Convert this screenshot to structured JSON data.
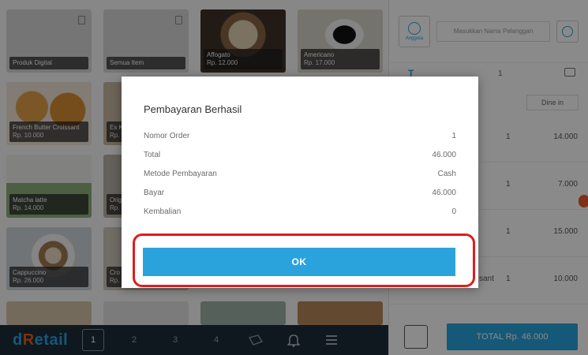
{
  "products": [
    {
      "name": "Produk Digital",
      "price": ""
    },
    {
      "name": "Semua Item",
      "price": ""
    },
    {
      "name": "Affogato",
      "price": "Rp. 12.000"
    },
    {
      "name": "Americano",
      "price": "Rp. 17.000"
    },
    {
      "name": "French Butter Croissant",
      "price": "Rp. 10.000"
    },
    {
      "name": "Es K",
      "price": "Rp."
    },
    {
      "name": "Matcha latte",
      "price": "Rp. 14.000"
    },
    {
      "name": "Origi",
      "price": "Rp."
    },
    {
      "name": "Cappuccino",
      "price": "Rp. 26.000"
    },
    {
      "name": "Cro",
      "price": "Rp."
    }
  ],
  "bottom_bar": {
    "logo_prefix": "d",
    "logo_r": "R",
    "logo_suffix": "etail",
    "pages": [
      "1",
      "2",
      "3",
      "4"
    ]
  },
  "side": {
    "member_label": "Anggota",
    "customer_placeholder": "Masukkan Nama Pelanggan",
    "qty_header": "1",
    "dine_in": "Dine in",
    "rows": [
      {
        "qty": "1",
        "price": "14.000"
      },
      {
        "qty": "1",
        "price": "7.000"
      },
      {
        "qty": "1",
        "price": "15.000"
      },
      {
        "qty": "1",
        "price": "10.000",
        "name_fragment": "sant"
      }
    ],
    "total_label": "TOTAL Rp. 46.000"
  },
  "modal": {
    "title": "Pembayaran Berhasil",
    "rows": [
      {
        "label": "Nomor Order",
        "value": "1"
      },
      {
        "label": "Total",
        "value": "46.000"
      },
      {
        "label": "Metode Pembayaran",
        "value": "Cash"
      },
      {
        "label": "Bayar",
        "value": "46.000"
      },
      {
        "label": "Kembalian",
        "value": "0"
      }
    ],
    "ok_label": "OK"
  },
  "colors": {
    "accent": "#2aa3dd",
    "highlight": "#e01c1c",
    "logo_r": "#e85c1c"
  }
}
